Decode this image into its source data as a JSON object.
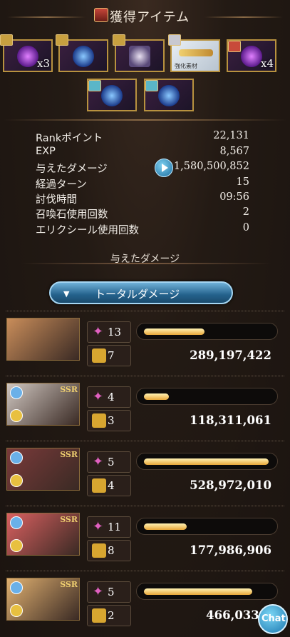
{
  "header": {
    "title": "獲得アイテム"
  },
  "items": [
    {
      "qty": "x3",
      "color": "#a040e0"
    },
    {
      "qty": "",
      "color": "#3a7af0"
    },
    {
      "qty": "",
      "color": "#9a8ab0"
    },
    {
      "qty": "",
      "color": "#f0d070",
      "tag": "強化素材"
    },
    {
      "qty": "x4",
      "color": "#a040e0"
    },
    {
      "qty": "",
      "color": "#3a7af0"
    },
    {
      "qty": "",
      "color": "#3a7af0"
    }
  ],
  "stats": [
    {
      "label": "Rankポイント",
      "value": "22,131"
    },
    {
      "label": "EXP",
      "value": "8,567"
    },
    {
      "label": "与えたダメージ",
      "value": "1,580,500,852"
    },
    {
      "label": "経過ターン",
      "value": "15"
    },
    {
      "label": "討伐時間",
      "value": "09:56"
    },
    {
      "label": "召喚石使用回数",
      "value": "2"
    },
    {
      "label": "エリクシール使用回数",
      "value": "0"
    }
  ],
  "damage_section": {
    "title": "与えたダメージ",
    "toggle_label": "トータルダメージ"
  },
  "party": [
    {
      "skills": "13",
      "attacks": "7",
      "damage": "289,197,422",
      "fill": 0.48,
      "badge": "",
      "portrait": "#c98d5a"
    },
    {
      "skills": "4",
      "attacks": "3",
      "damage": "118,311,061",
      "fill": 0.2,
      "badge": "SSR",
      "portrait": "#cfc6c0"
    },
    {
      "skills": "5",
      "attacks": "4",
      "damage": "528,972,010",
      "fill": 0.99,
      "badge": "SSR",
      "portrait": "#7a3a3a"
    },
    {
      "skills": "11",
      "attacks": "8",
      "damage": "177,986,906",
      "fill": 0.34,
      "badge": "SSR",
      "portrait": "#d96060"
    },
    {
      "skills": "5",
      "attacks": "2",
      "damage": "466,033,4",
      "fill": 0.86,
      "badge": "SSR",
      "portrait": "#e0b070"
    }
  ],
  "chat": {
    "label": "Chat"
  }
}
